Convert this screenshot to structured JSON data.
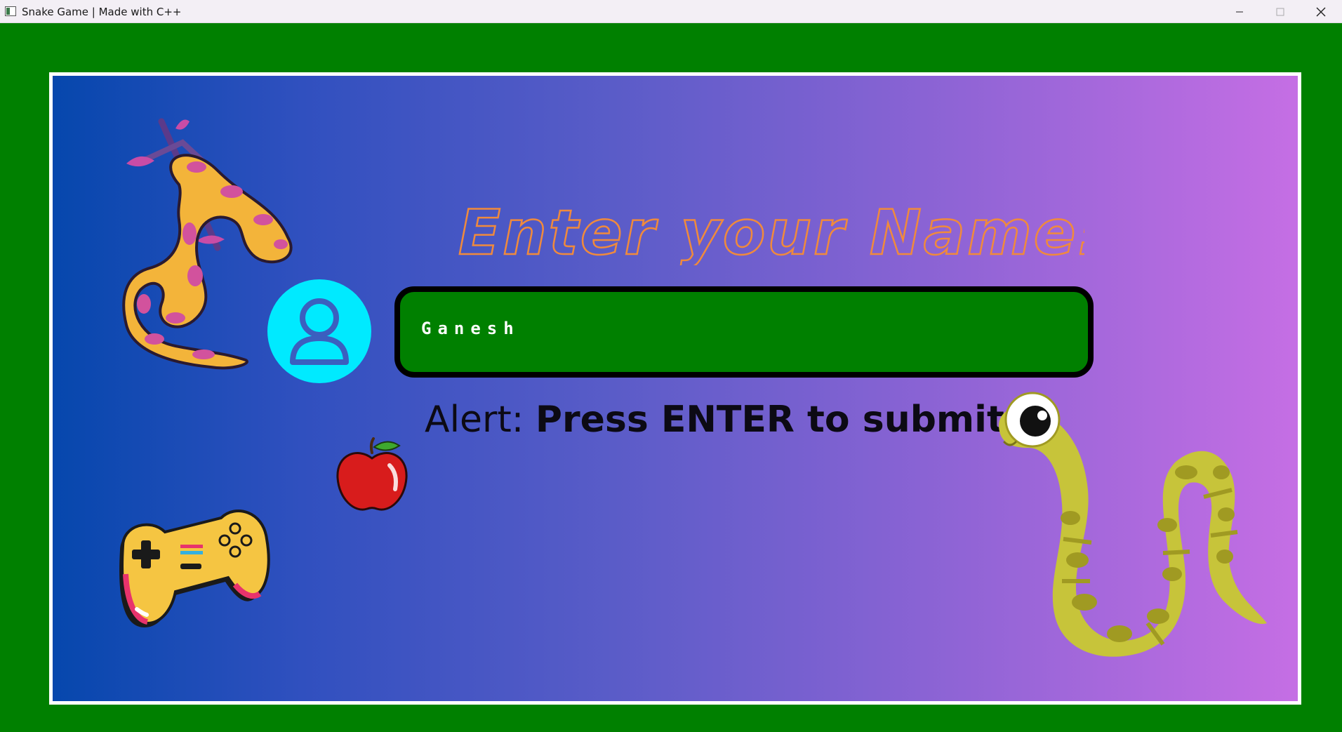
{
  "window": {
    "title": "Snake Game | Made with C++",
    "controls": [
      "minimize",
      "maximize",
      "close"
    ]
  },
  "screen": {
    "heading": "Enter your Name:",
    "name_input": {
      "value": "Ganesh"
    },
    "alert": {
      "label": "Alert:",
      "message": "Press ENTER to submit"
    }
  },
  "colors": {
    "background": "#008000",
    "frame_border": "#ffffff",
    "gradient_start": "#0647ad",
    "gradient_end": "#c56ee4",
    "heading_outline": "#f08a3c",
    "input_fill": "#008000",
    "avatar": "#00eaff"
  },
  "decorations": [
    "python-snake-illustration",
    "user-avatar-icon",
    "apple-icon",
    "gamepad-icon",
    "green-snake-illustration"
  ]
}
